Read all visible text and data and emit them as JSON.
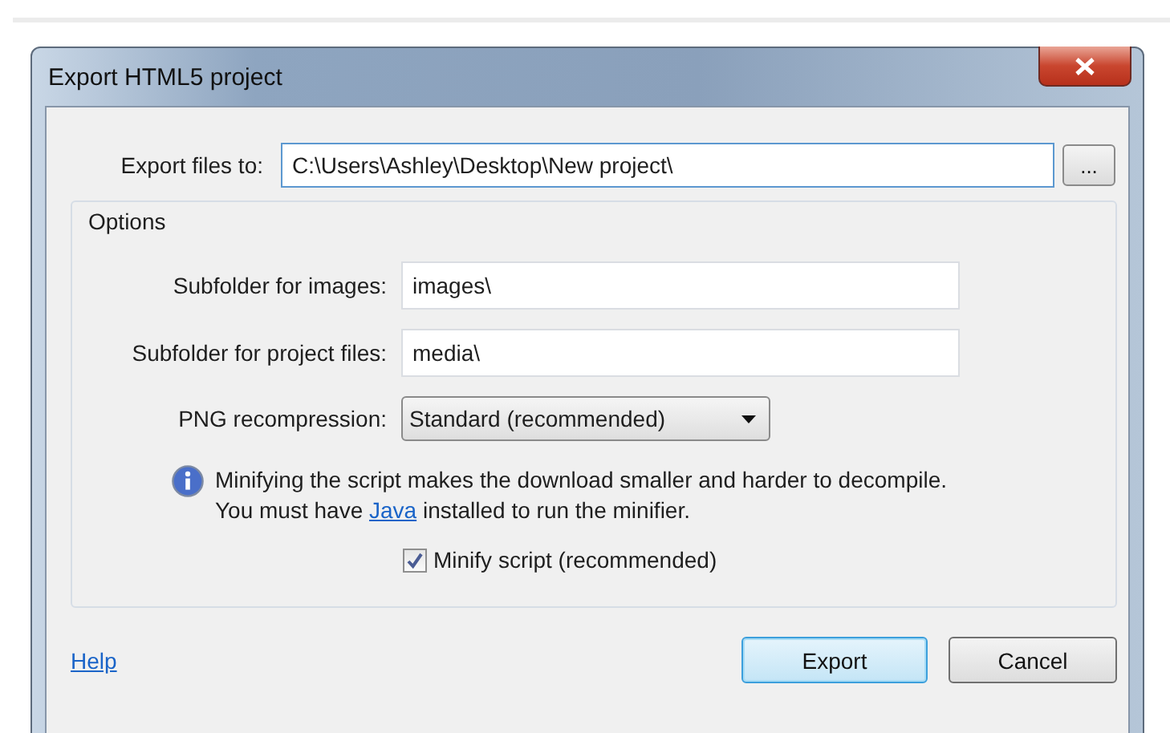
{
  "window": {
    "title": "Export HTML5 project"
  },
  "export_files_to": {
    "label": "Export files to:",
    "value": "C:\\Users\\Ashley\\Desktop\\New project\\",
    "browse": "..."
  },
  "options": {
    "title": "Options",
    "fields": [
      {
        "label": "Subfolder for images:",
        "kind": "text",
        "value": "images\\"
      },
      {
        "label": "Subfolder for project files:",
        "kind": "text",
        "value": "media\\"
      },
      {
        "label": "PNG recompression:",
        "kind": "dropdown",
        "value": "Standard (recommended)"
      }
    ],
    "info": {
      "line1": "Minifying the script makes the download smaller and harder to decompile.",
      "line2_before": "You must have ",
      "link": "Java",
      "line2_after": " installed to run the minifier."
    },
    "checkbox": {
      "label": "Minify script (recommended)",
      "checked": true
    }
  },
  "help_link": "Help",
  "buttons": [
    {
      "label": "Export",
      "default": true
    },
    {
      "label": "Cancel",
      "default": false
    }
  ]
}
